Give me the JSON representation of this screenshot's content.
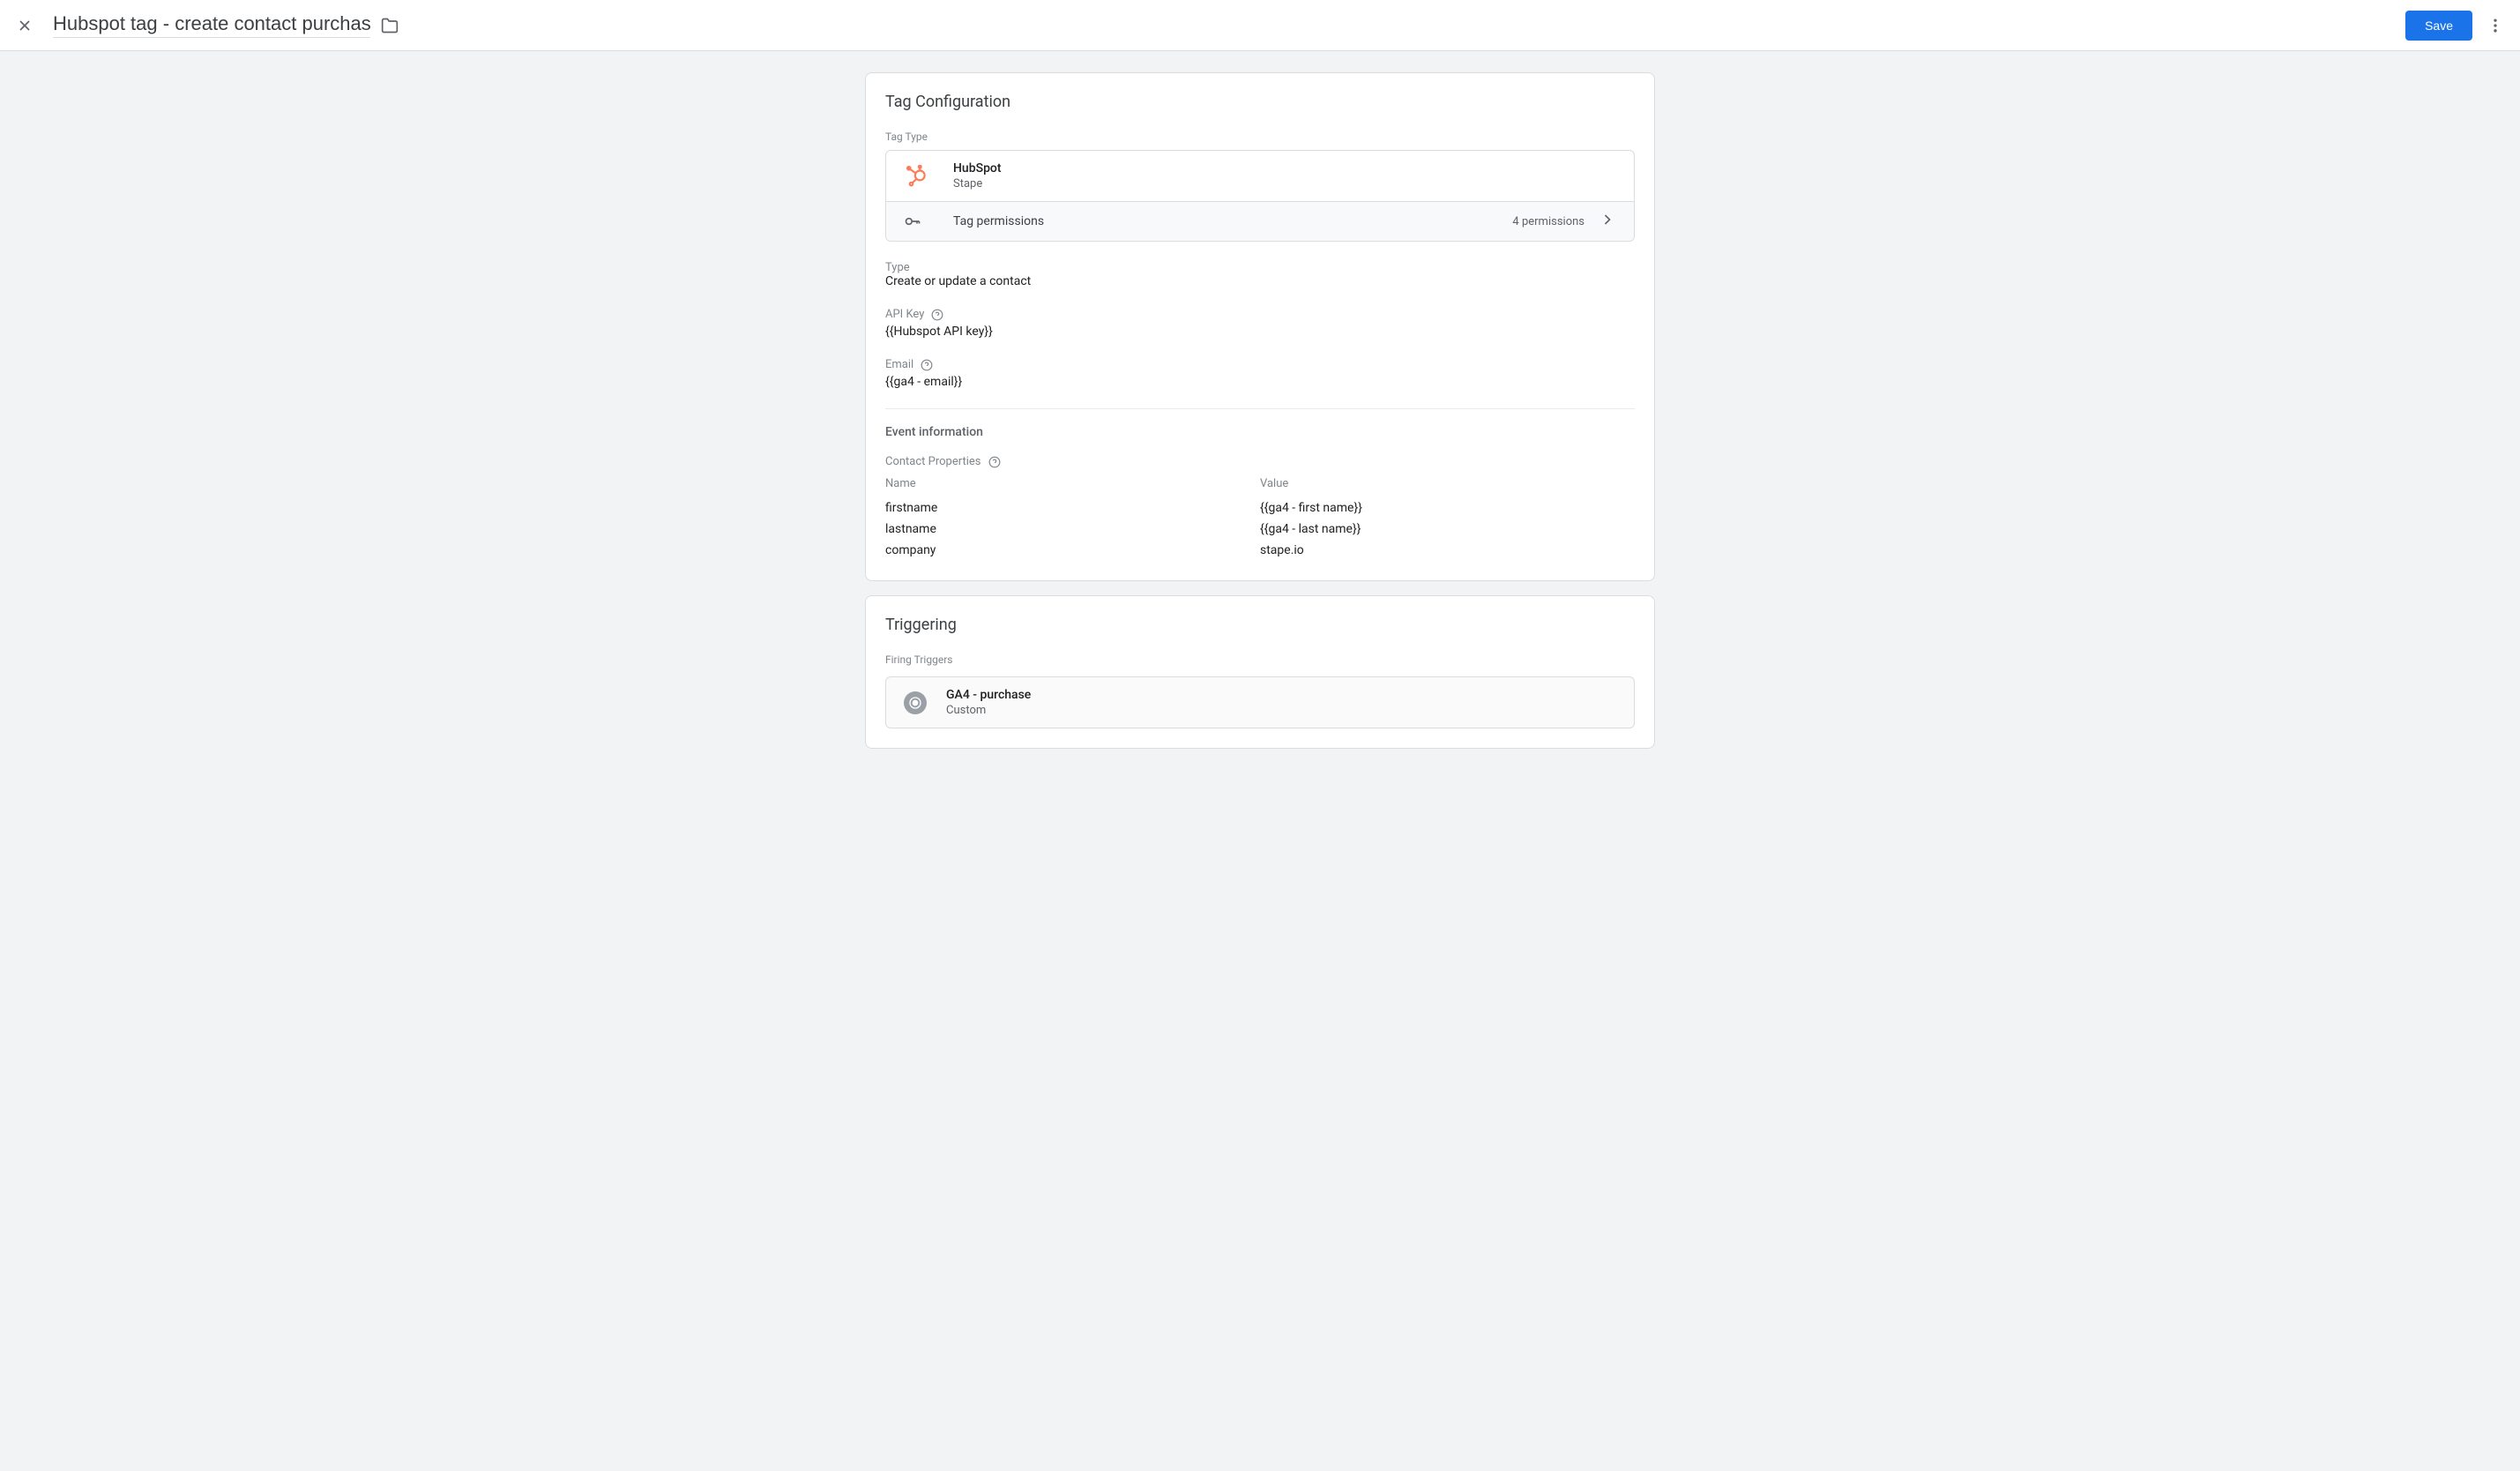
{
  "header": {
    "title": "Hubspot tag - create contact purchase",
    "save_label": "Save"
  },
  "tag_config": {
    "card_title": "Tag Configuration",
    "tag_type_label": "Tag Type",
    "tag_type_name": "HubSpot",
    "tag_type_vendor": "Stape",
    "permissions_label": "Tag permissions",
    "permissions_count": "4 permissions",
    "type_label": "Type",
    "type_value": "Create or update a contact",
    "api_key_label": "API Key",
    "api_key_value": "{{Hubspot API key}}",
    "email_label": "Email",
    "email_value": "{{ga4 - email}}",
    "event_info_title": "Event information",
    "contact_props_label": "Contact Properties",
    "props_header_name": "Name",
    "props_header_value": "Value",
    "props": [
      {
        "name": "firstname",
        "value": "{{ga4 - first name}}"
      },
      {
        "name": "lastname",
        "value": "{{ga4 - last name}}"
      },
      {
        "name": "company",
        "value": "stape.io"
      }
    ]
  },
  "triggering": {
    "card_title": "Triggering",
    "firing_triggers_label": "Firing Triggers",
    "trigger_name": "GA4 - purchase",
    "trigger_type": "Custom"
  }
}
